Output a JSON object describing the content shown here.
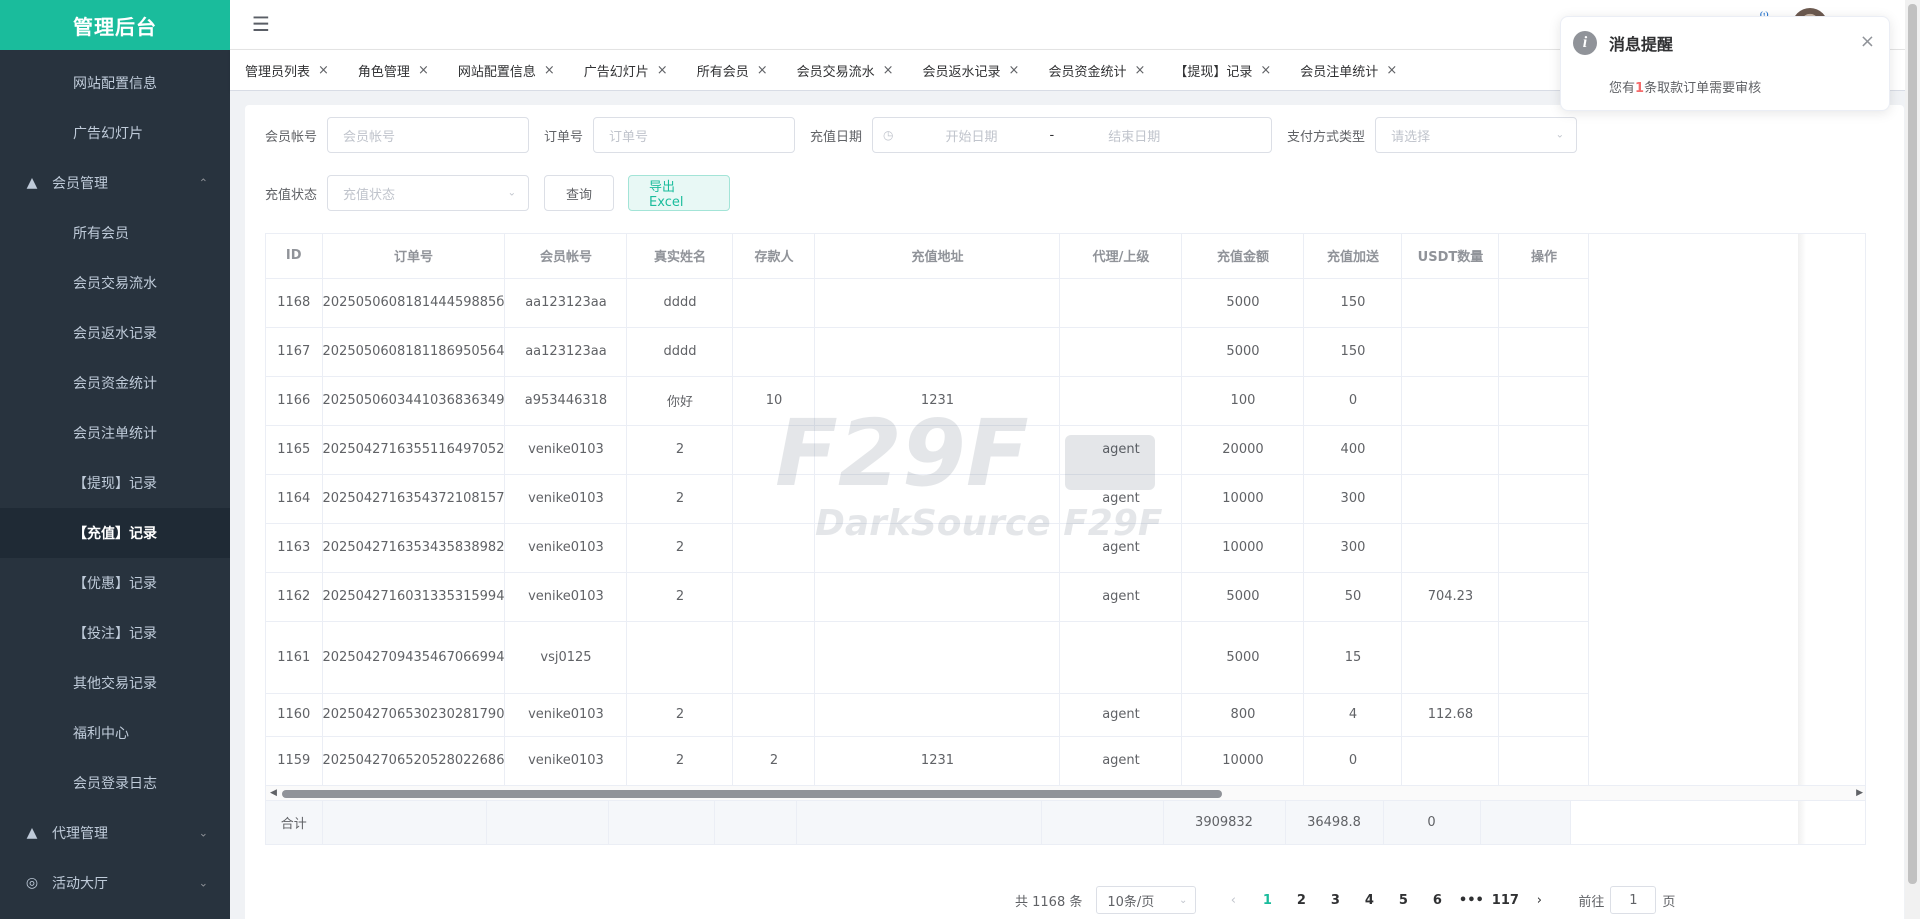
{
  "app": {
    "title": "管理后台"
  },
  "sidebar": {
    "items": [
      {
        "label": "网站配置信息",
        "type": "sub"
      },
      {
        "label": "广告幻灯片",
        "type": "sub"
      },
      {
        "label": "会员管理",
        "type": "group",
        "icon": "user-icon",
        "expanded": true
      },
      {
        "label": "所有会员",
        "type": "sub"
      },
      {
        "label": "会员交易流水",
        "type": "sub"
      },
      {
        "label": "会员返水记录",
        "type": "sub"
      },
      {
        "label": "会员资金统计",
        "type": "sub"
      },
      {
        "label": "会员注单统计",
        "type": "sub"
      },
      {
        "label": "【提现】记录",
        "type": "sub"
      },
      {
        "label": "【充值】记录",
        "type": "sub",
        "active": true
      },
      {
        "label": "【优惠】记录",
        "type": "sub"
      },
      {
        "label": "【投注】记录",
        "type": "sub"
      },
      {
        "label": "其他交易记录",
        "type": "sub"
      },
      {
        "label": "福利中心",
        "type": "sub"
      },
      {
        "label": "会员登录日志",
        "type": "sub"
      },
      {
        "label": "代理管理",
        "type": "group",
        "icon": "user-icon"
      },
      {
        "label": "活动大厅",
        "type": "group",
        "icon": "gift-icon"
      }
    ]
  },
  "tabs": [
    "管理员列表",
    "角色管理",
    "网站配置信息",
    "广告幻灯片",
    "所有会员",
    "会员交易流水",
    "会员返水记录",
    "会员资金统计",
    "【提现】记录",
    "会员注单统计"
  ],
  "filters": {
    "account_label": "会员帐号",
    "account_placeholder": "会员帐号",
    "order_label": "订单号",
    "order_placeholder": "订单号",
    "date_label": "充值日期",
    "date_start": "开始日期",
    "date_sep": "-",
    "date_end": "结束日期",
    "pay_label": "支付方式类型",
    "pay_placeholder": "请选择",
    "status_label": "充值状态",
    "status_placeholder": "充值状态",
    "query_button": "查询",
    "export_button": "导出Excel"
  },
  "table": {
    "columns": [
      "ID",
      "订单号",
      "会员帐号",
      "真实姓名",
      "存款人",
      "充值地址",
      "代理/上级",
      "充值金额",
      "充值加送",
      "USDT数量",
      "操作"
    ],
    "rows": [
      [
        "1168",
        "202505060818144459885б",
        "aa123123aa",
        "dddd",
        "",
        "",
        "",
        "5000",
        "150",
        ""
      ],
      [
        "1167",
        "2025050608181186950564",
        "aa123123aa",
        "dddd",
        "",
        "",
        "",
        "5000",
        "150",
        ""
      ],
      [
        "1166",
        "2025050603441036836349",
        "a953446318",
        "你好",
        "10",
        "1231",
        "",
        "100",
        "0",
        ""
      ],
      [
        "1165",
        "2025042716355116497052",
        "venike0103",
        "2",
        "",
        "",
        "agent",
        "20000",
        "400",
        ""
      ],
      [
        "1164",
        "2025042716354372108157",
        "venike0103",
        "2",
        "",
        "",
        "agent",
        "10000",
        "300",
        ""
      ],
      [
        "1163",
        "2025042716353435838982",
        "venike0103",
        "2",
        "",
        "",
        "agent",
        "10000",
        "300",
        ""
      ],
      [
        "1162",
        "2025042716031335315994",
        "venike0103",
        "2",
        "",
        "",
        "agent",
        "5000",
        "50",
        "704.23"
      ],
      [
        "1161",
        "2025042709435467066994",
        "vsj0125",
        "",
        "",
        "",
        "",
        "5000",
        "15",
        ""
      ],
      [
        "1160",
        "2025042706530230281790",
        "venike0103",
        "2",
        "",
        "",
        "agent",
        "800",
        "4",
        "112.68"
      ],
      [
        "1159",
        "2025042706520528022686",
        "venike0103",
        "2",
        "2",
        "1231",
        "agent",
        "10000",
        "0",
        ""
      ]
    ],
    "summary": {
      "label": "合计",
      "amount": "3909832",
      "bonus": "36498.8",
      "usdt": "0"
    }
  },
  "pagination": {
    "total": "共 1168 条",
    "page_size": "10条/页",
    "pages": [
      "1",
      "2",
      "3",
      "4",
      "5",
      "6",
      "•••",
      "117"
    ],
    "current": "1",
    "goto_label": "前往",
    "goto_value": "1",
    "goto_suffix": "页"
  },
  "notification": {
    "title": "消息提醒",
    "body_prefix": "您有",
    "count": "1",
    "body_suffix": "条取款订单需要审核"
  },
  "watermark": {
    "line1": "F29F",
    "line2": "DarkSource F29F"
  }
}
